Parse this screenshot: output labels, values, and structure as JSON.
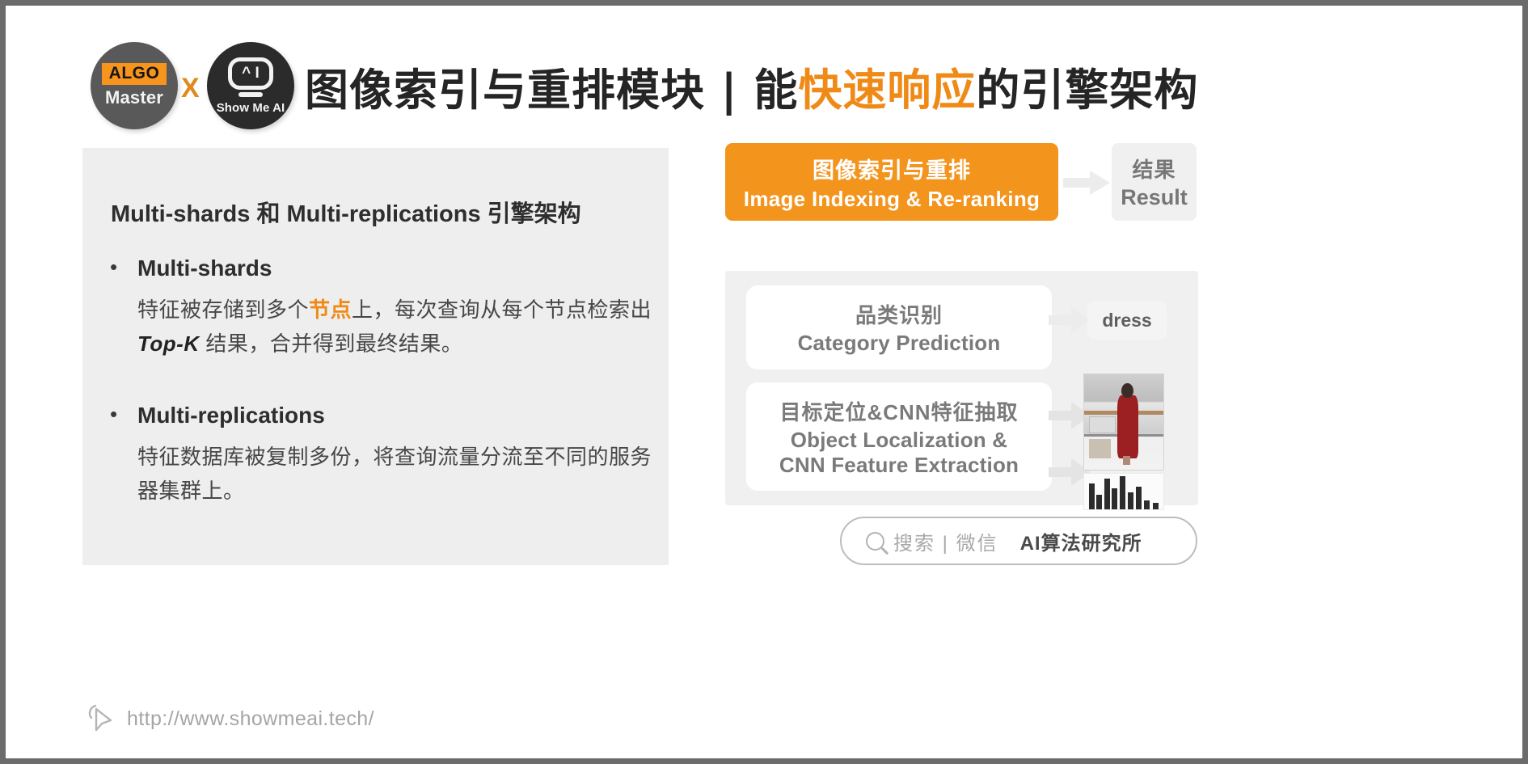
{
  "brand": {
    "logo_left_tag": "ALGO",
    "logo_left_sub": "Master",
    "logo_x": "X",
    "logo_right_eyes": "^ I",
    "logo_right_sub": "Show Me AI"
  },
  "header": {
    "title_part1": "图像索引与重排模块 | 能",
    "title_highlight": "快速响应",
    "title_part2": "的引擎架构",
    "accent_color": "#ef8a17"
  },
  "left_panel": {
    "heading": "Multi-shards 和 Multi-replications 引擎架构",
    "bullets": [
      {
        "marker": "•",
        "title": "Multi-shards",
        "body_pre": "特征被存储到多个",
        "body_highlight": "节点",
        "body_mid": "上，每次查询从每个节点检索出 ",
        "body_bold": "Top-K",
        "body_post": " 结果，合并得到最终结果。"
      },
      {
        "marker": "•",
        "title": "Multi-replications",
        "body_pre": "特征数据库被复制多份，将查询流量分流至不同的服务器集群上。",
        "body_highlight": "",
        "body_mid": "",
        "body_bold": "",
        "body_post": ""
      }
    ]
  },
  "right_panel": {
    "main_box": {
      "cn": "图像索引与重排",
      "en": "Image Indexing & Re-ranking",
      "color": "#f3941d"
    },
    "result_box": {
      "cn": "结果",
      "en": "Result"
    },
    "cards": [
      {
        "cn": "品类识别",
        "en": "Category Prediction",
        "output": "dress"
      },
      {
        "cn": "目标定位&CNN特征抽取",
        "en_line1": "Object Localization &",
        "en_line2": "CNN Feature Extraction"
      }
    ],
    "search_bar": {
      "hint": "搜索 | 微信",
      "brand": "AI算法研究所",
      "icon": "search-icon"
    }
  },
  "footer": {
    "url": "http://www.showmeai.tech/",
    "icon": "cursor-icon"
  }
}
